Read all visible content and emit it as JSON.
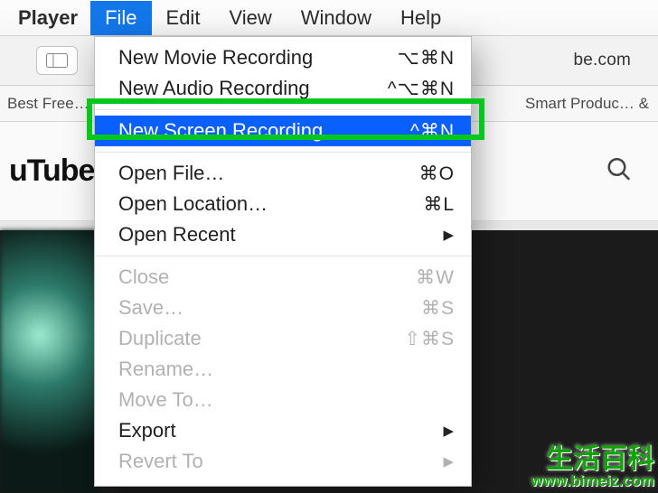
{
  "menubar": {
    "app": "Player",
    "items": [
      "File",
      "Edit",
      "View",
      "Window",
      "Help"
    ],
    "active_index": 0
  },
  "toolbar": {
    "domain_fragment": "be.com"
  },
  "bookmarks": {
    "left": "Best Free…",
    "right": "Smart Produc… &"
  },
  "youtube": {
    "logo_fragment": "uTube"
  },
  "file_menu": [
    {
      "label": "New Movie Recording",
      "shortcut": "⌥⌘N",
      "enabled": true,
      "selected": false
    },
    {
      "label": "New Audio Recording",
      "shortcut": "^⌥⌘N",
      "enabled": true,
      "selected": false
    },
    {
      "separator": true
    },
    {
      "label": "New Screen Recording",
      "shortcut": "^⌘N",
      "enabled": true,
      "selected": true
    },
    {
      "separator": true
    },
    {
      "label": "Open File…",
      "shortcut": "⌘O",
      "enabled": true,
      "selected": false
    },
    {
      "label": "Open Location…",
      "shortcut": "⌘L",
      "enabled": true,
      "selected": false
    },
    {
      "label": "Open Recent",
      "shortcut": "▶",
      "enabled": true,
      "selected": false,
      "submenu": true
    },
    {
      "separator": true
    },
    {
      "label": "Close",
      "shortcut": "⌘W",
      "enabled": false,
      "selected": false
    },
    {
      "label": "Save…",
      "shortcut": "⌘S",
      "enabled": false,
      "selected": false
    },
    {
      "label": "Duplicate",
      "shortcut": "⇧⌘S",
      "enabled": false,
      "selected": false
    },
    {
      "label": "Rename…",
      "shortcut": "",
      "enabled": false,
      "selected": false
    },
    {
      "label": "Move To…",
      "shortcut": "",
      "enabled": false,
      "selected": false
    },
    {
      "label": "Export",
      "shortcut": "▶",
      "enabled": true,
      "selected": false,
      "submenu": true
    },
    {
      "label": "Revert To",
      "shortcut": "▶",
      "enabled": false,
      "selected": false,
      "submenu": true
    }
  ],
  "watermark": {
    "cn": "生活百科",
    "url": "www.bimeiz.com"
  }
}
